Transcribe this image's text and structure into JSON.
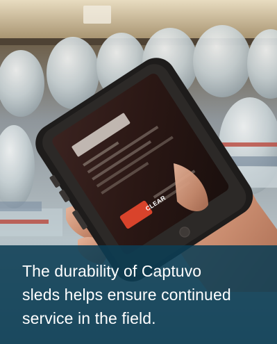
{
  "caption": {
    "lines": [
      "The durability of Captuvo",
      "sleds helps ensure continued",
      "service in the field."
    ]
  },
  "screen": {
    "button_label": "CLEAR"
  },
  "colors": {
    "caption_panel": "#0c3e54",
    "caption_text": "#ffffff",
    "clear_button": "#d9432b"
  }
}
